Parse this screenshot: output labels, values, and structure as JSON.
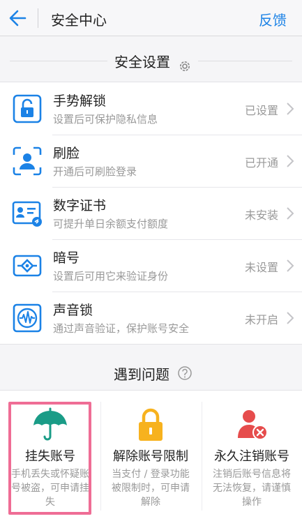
{
  "header": {
    "title": "安全中心",
    "feedback": "反馈"
  },
  "security_settings": {
    "title": "安全设置",
    "items": [
      {
        "title": "手势解锁",
        "subtitle": "设置后可保护隐私信息",
        "status": "已设置",
        "icon": "lock-icon"
      },
      {
        "title": "刷脸",
        "subtitle": "开通后可刷脸登录",
        "status": "已开通",
        "icon": "face-scan-icon"
      },
      {
        "title": "数字证书",
        "subtitle": "可提升单日余额支付额度",
        "status": "未安装",
        "icon": "certificate-icon"
      },
      {
        "title": "暗号",
        "subtitle": "设置后可用它来验证身份",
        "status": "未设置",
        "icon": "code-icon"
      },
      {
        "title": "声音锁",
        "subtitle": "通过声音验证，保护账号安全",
        "status": "未开启",
        "icon": "voice-wave-icon"
      }
    ]
  },
  "problems": {
    "title": "遇到问题",
    "cards": [
      {
        "title": "挂失账号",
        "desc": "手机丢失或怀疑账\n号被盗，可申请挂\n失",
        "icon": "umbrella-icon"
      },
      {
        "title": "解除账号限制",
        "desc": "当支付 / 登录功能\n被限制时，可申请\n解除",
        "icon": "padlock-icon"
      },
      {
        "title": "永久注销账号",
        "desc": "注销后账号信息将\n无法恢复，请谨慎\n操作",
        "icon": "user-delete-icon"
      }
    ]
  },
  "colors": {
    "accent": "#1b82e6",
    "umbrella": "#1a9c87",
    "lock": "#f7b21e",
    "delete": "#e64c4c",
    "highlight": "#ef6d95"
  }
}
